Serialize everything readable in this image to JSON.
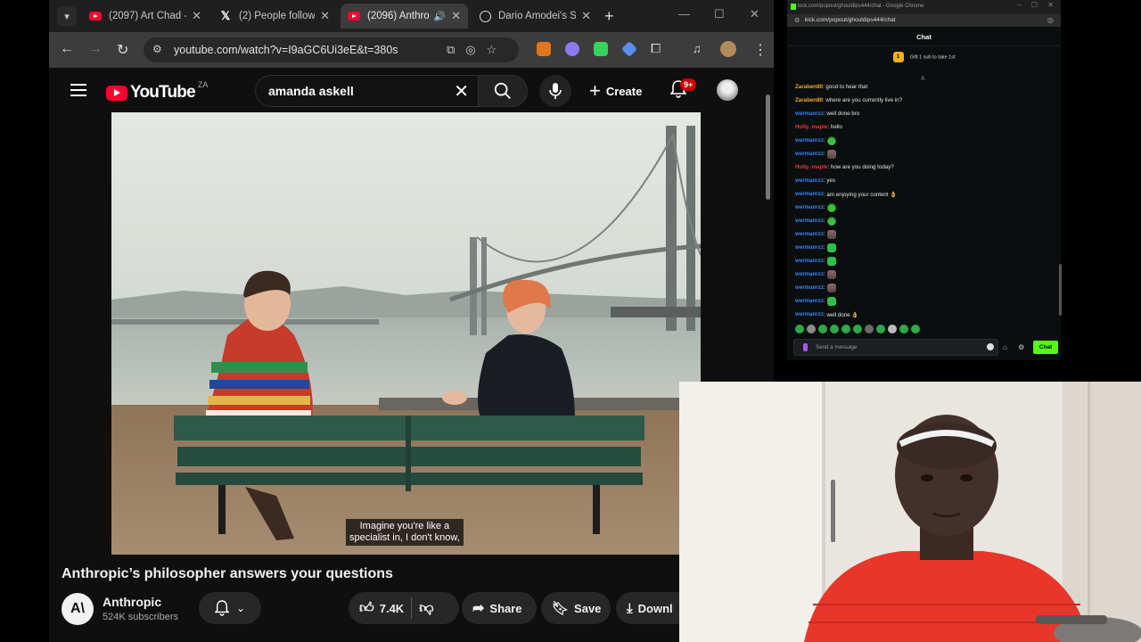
{
  "browser": {
    "tabs": [
      {
        "title": "(2097) Art Chad -",
        "favicon": "youtube-icon",
        "active": false
      },
      {
        "title": "(2) People follow",
        "favicon": "x-icon",
        "active": false
      },
      {
        "title": "(2096) Anthro",
        "favicon": "youtube-icon",
        "active": true
      },
      {
        "title": "Dario Amodei's S",
        "favicon": "globe-icon",
        "active": false
      }
    ],
    "url": "youtube.com/watch?v=I9aGC6Ui3eE&t=380s"
  },
  "youtube": {
    "logo_text": "YouTube",
    "country_code": "ZA",
    "search_query": "amanda askell",
    "create_label": "Create",
    "notification_badge": "9+",
    "caption_line1": "Imagine you're like a",
    "caption_line2": "specialist in, I don't know,",
    "video_title": "Anthropic’s philosopher answers your questions",
    "channel_initials": "A\\",
    "channel_name": "Anthropic",
    "subscribers": "524K subscribers",
    "likes": "7.4K",
    "share_label": "Share",
    "save_label": "Save",
    "download_label": "Downl"
  },
  "kick": {
    "window_title": "kick.com/popout/ghouldips444/chat - Google Chrome",
    "url": "kick.com/popout/ghouldips444/chat",
    "header": "Chat",
    "gift_count": "1",
    "gift_text": "Gift 1 sub to take 1st",
    "input_placeholder": "Send a message",
    "chat_button": "Chat",
    "messages": [
      {
        "user": "Zaraben80",
        "color": "#f5a623",
        "text": ": good to hear that",
        "emote": ""
      },
      {
        "user": "Zaraben80",
        "color": "#f5a623",
        "text": ": where are you currently live in?",
        "emote": ""
      },
      {
        "user": "wermanrzz",
        "color": "#3b82f6",
        "text": ": well done bro",
        "emote": ""
      },
      {
        "user": "Holly_maple",
        "color": "#e53935",
        "text": ": hello",
        "emote": ""
      },
      {
        "user": "wermanrzz",
        "color": "#3b82f6",
        "text": ":",
        "emote": "frog"
      },
      {
        "user": "wermanrzz",
        "color": "#3b82f6",
        "text": ":",
        "emote": "cat"
      },
      {
        "user": "Holly_maple",
        "color": "#e53935",
        "text": ": how are you doing today?",
        "emote": ""
      },
      {
        "user": "wermanrzz",
        "color": "#3b82f6",
        "text": ": yes",
        "emote": ""
      },
      {
        "user": "wermanrzz",
        "color": "#3b82f6",
        "text": ": am enjoying your content 👌",
        "emote": ""
      },
      {
        "user": "wermanrzz",
        "color": "#3b82f6",
        "text": ":",
        "emote": "frog"
      },
      {
        "user": "wermanrzz",
        "color": "#3b82f6",
        "text": ":",
        "emote": "frog"
      },
      {
        "user": "wermanrzz",
        "color": "#3b82f6",
        "text": ":",
        "emote": "cat"
      },
      {
        "user": "wermanrzz",
        "color": "#3b82f6",
        "text": ":",
        "emote": "bin"
      },
      {
        "user": "wermanrzz",
        "color": "#3b82f6",
        "text": ":",
        "emote": "bin"
      },
      {
        "user": "wermanrzz",
        "color": "#3b82f6",
        "text": ":",
        "emote": "cat"
      },
      {
        "user": "wermanrzz",
        "color": "#3b82f6",
        "text": ":",
        "emote": "cat"
      },
      {
        "user": "wermanrzz",
        "color": "#3b82f6",
        "text": ":",
        "emote": "bin"
      },
      {
        "user": "wermanrzz",
        "color": "#3b82f6",
        "text": ": well done 👌",
        "emote": ""
      }
    ]
  },
  "colors": {
    "youtube_red": "#ff0033",
    "kick_green": "#53fc18",
    "sweater": "#e8362b"
  }
}
